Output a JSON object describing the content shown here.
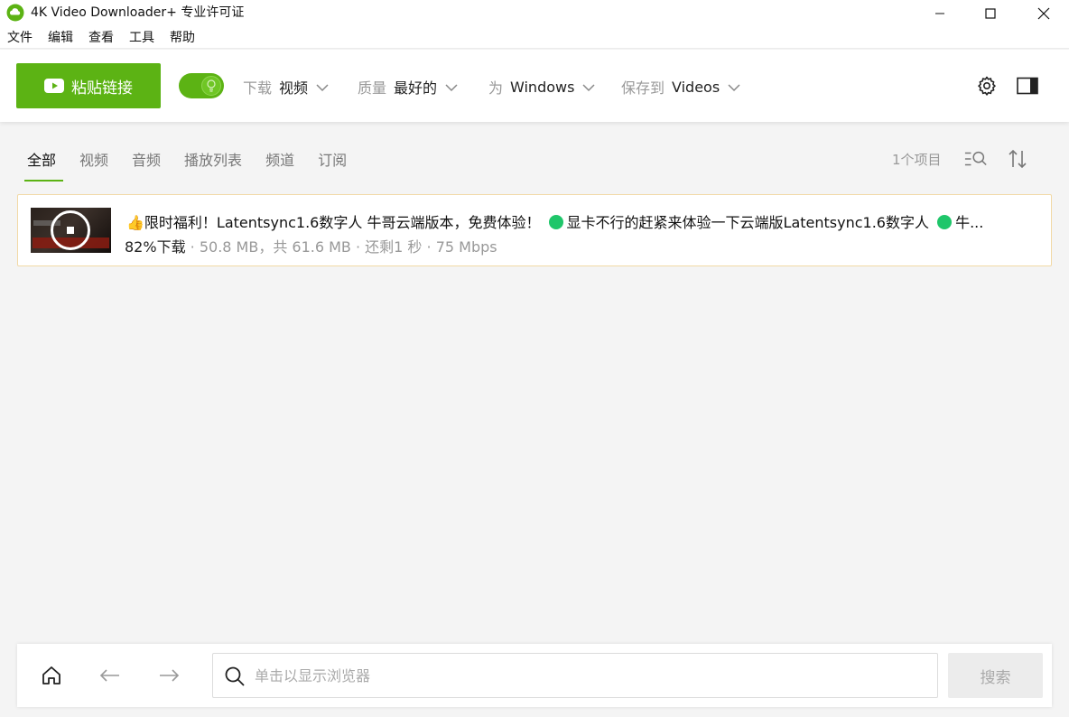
{
  "window": {
    "title": "4K Video Downloader+ 专业许可证",
    "controls": [
      "minimize-icon",
      "maximize-icon",
      "close-icon"
    ]
  },
  "menu": {
    "items": [
      "文件",
      "编辑",
      "查看",
      "工具",
      "帮助"
    ]
  },
  "toolbar": {
    "paste_label": "粘贴链接",
    "smart_mode_on": true,
    "download_label": "下载",
    "download_value": "视频",
    "quality_label": "质量",
    "quality_value": "最好的",
    "for_label": "为",
    "for_value": "Windows",
    "save_label": "保存到",
    "save_value": "Videos",
    "accent_color": "#5cb314"
  },
  "tabs": {
    "items": [
      "全部",
      "视频",
      "音频",
      "播放列表",
      "频道",
      "订阅"
    ],
    "active": "全部",
    "count": "1个项目"
  },
  "downloads": [
    {
      "title_part1": "👍限时福利！Latentsync1.6数字人 牛哥云端版本，免费体验！",
      "title_part2": "显卡不行的赶紧来体验一下云端版Latentsync1.6数字人",
      "title_part3": "牛...",
      "progress": "82%下载",
      "status_rest": " · 50.8 MB，共 61.6 MB · 还剩1 秒 · 75 Mbps"
    }
  ],
  "bottom": {
    "search_placeholder": "单击以显示浏览器",
    "search_button": "搜索"
  }
}
